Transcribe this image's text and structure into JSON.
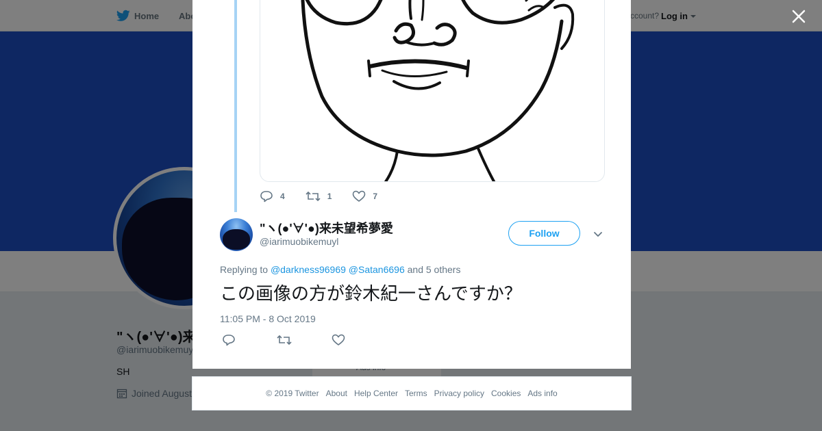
{
  "nav": {
    "home_label": "Home",
    "about_label": "Abo",
    "account_prompt": "Have an account?",
    "login_label": "Log in"
  },
  "profile": {
    "display_name": "\"ヽ(●'∀'●)来",
    "handle": "@iarimuobikemuyl",
    "bio": "SH",
    "joined": "Joined August",
    "ads_info": "Ads info"
  },
  "tweet_above": {
    "reply_count": "4",
    "retweet_count": "1",
    "like_count": "7"
  },
  "tweet": {
    "display_name": "\"ヽ(●'∀'●)来未望希夢愛",
    "handle": "@iarimuobikemuyl",
    "follow_label": "Follow",
    "replying_prefix": "Replying to",
    "mention_1": "@darkness96969",
    "mention_2": "@Satan6696",
    "others": "and 5 others",
    "text": "この画像の方が鈴木紀一さんですか？",
    "timestamp": "11:05 PM - 8 Oct 2019"
  },
  "footer": {
    "links": [
      "© 2019 Twitter",
      "About",
      "Help Center",
      "Terms",
      "Privacy policy",
      "Cookies",
      "Ads info"
    ]
  },
  "colors": {
    "accent": "#1da1f2",
    "banner": "#1d4ec4",
    "thread_line": "#a6d3f5"
  }
}
